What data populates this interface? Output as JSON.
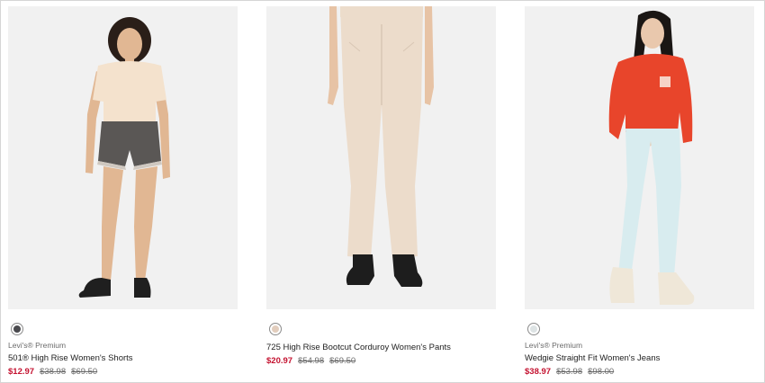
{
  "products": [
    {
      "brand": "Levi's® Premium",
      "name": "501® High Rise Women's Shorts",
      "sale_price": "$12.97",
      "original_price": "$38.98",
      "list_price": "$69.50",
      "swatch_color": "#4a4a4e",
      "image": {
        "kind": "model-shorts",
        "top_color": "#f4e2cd",
        "bottom_color": "#5a5755",
        "skin": "#e1b793",
        "shoe_color": "#1f1f1f"
      }
    },
    {
      "brand": "",
      "name": "725 High Rise Bootcut Corduroy Women's Pants",
      "sale_price": "$20.97",
      "original_price": "$54.98",
      "list_price": "$69.50",
      "swatch_color": "#e2cdbd",
      "image": {
        "kind": "legs-pants",
        "bottom_color": "#ecdccb",
        "skin": "#e7c3a5",
        "shoe_color": "#1d1d1d"
      }
    },
    {
      "brand": "Levi's® Premium",
      "name": "Wedgie Straight Fit Women's Jeans",
      "sale_price": "$38.97",
      "original_price": "$53.98",
      "list_price": "$98.00",
      "swatch_color": "#dde3e4",
      "image": {
        "kind": "model-jeans",
        "top_color": "#e8452b",
        "bottom_color": "#d8ecef",
        "skin": "#e9c8ad",
        "shoe_color": "#efe7d8"
      }
    }
  ]
}
